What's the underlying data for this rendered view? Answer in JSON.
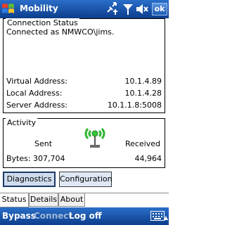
{
  "titlebar": {
    "title": "Mobility",
    "ok_label": "ok",
    "icons": [
      "windows-logo",
      "connectivity-icon",
      "signal-icon",
      "volume-icon"
    ]
  },
  "connection": {
    "group_title": "Connection Status",
    "status_text": "Connected as NMWCO\\jims.",
    "virtual_label": "Virtual Address:",
    "virtual_value": "10.1.4.89",
    "local_label": "Local Address:",
    "local_value": "10.1.4.28",
    "server_label": "Server Address:",
    "server_value": "10.1.1.8:5008"
  },
  "activity": {
    "group_title": "Activity",
    "sent_label": "Sent",
    "received_label": "Received",
    "bytes_label": "Bytes:",
    "sent_value": "307,704",
    "received_value": "44,964",
    "indicator_icon": "activity-antenna-icon"
  },
  "buttons": {
    "diagnostics": "Diagnostics",
    "configuration": "Configuration"
  },
  "tabs": [
    "Status",
    "Details",
    "About"
  ],
  "active_tab": "Status",
  "softkeys": {
    "bypass": "Bypass",
    "connect": "Connect",
    "logoff": "Log off"
  },
  "colors": {
    "titlebar": "#1a56b0",
    "antenna_green": "#2fb82f"
  }
}
